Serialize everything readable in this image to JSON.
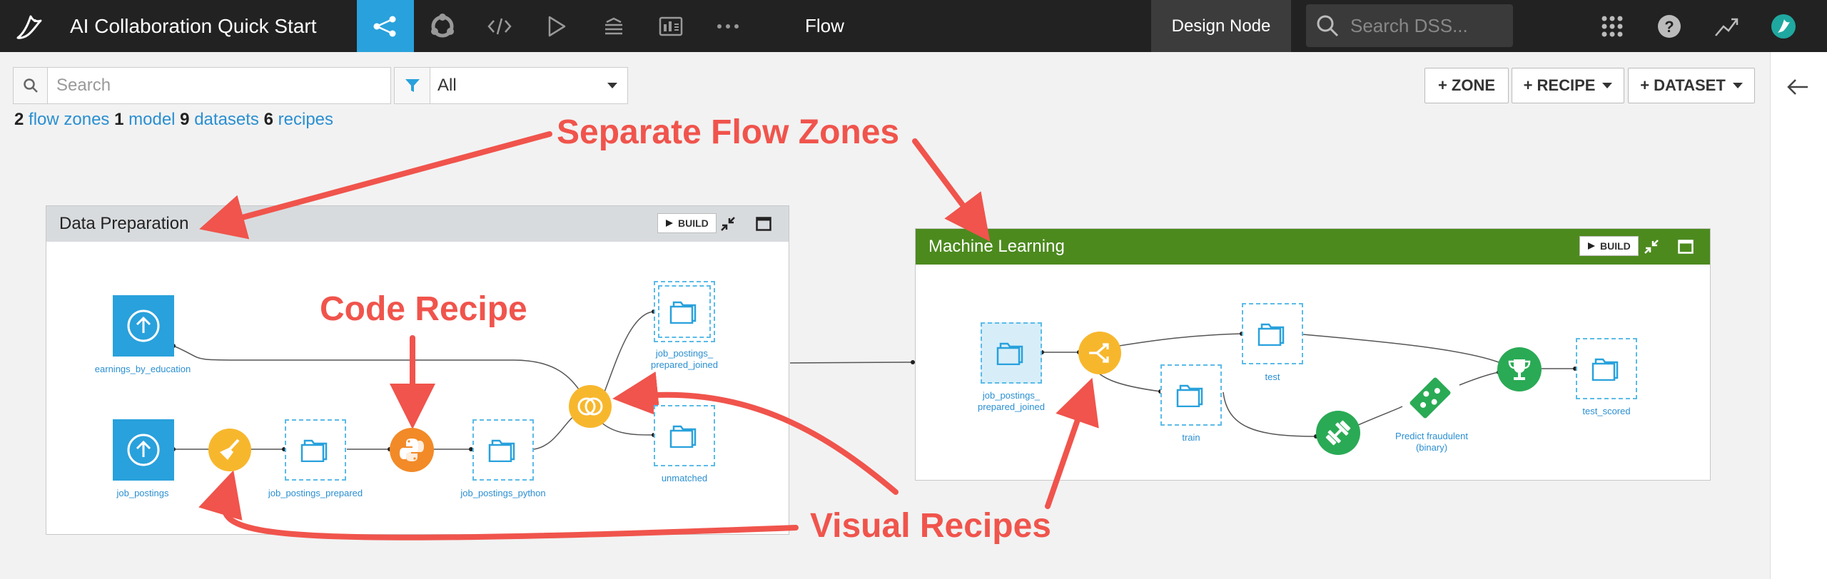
{
  "topbar": {
    "project_title": "AI Collaboration Quick Start",
    "icons": [
      "flow-icon",
      "jobs-icon",
      "code-icon",
      "run-icon",
      "library-icon",
      "dashboard-icon",
      "more-icon"
    ],
    "section": "Flow",
    "design_node": "Design Node",
    "search_placeholder": "Search DSS...",
    "right_icons": [
      "apps-grid-icon",
      "help-icon",
      "trend-icon",
      "profile-icon"
    ]
  },
  "toolbar": {
    "search_placeholder": "Search",
    "filter_value": "All",
    "zone_btn": "+ ZONE",
    "recipe_btn": "+ RECIPE",
    "dataset_btn": "+ DATASET"
  },
  "summary": {
    "zones_count": "2",
    "zones_label": "flow zones",
    "model_count": "1",
    "model_label": "model",
    "datasets_count": "9",
    "datasets_label": "datasets",
    "recipes_count": "6",
    "recipes_label": "recipes"
  },
  "zones": {
    "prep": {
      "title": "Data Preparation",
      "build": "BUILD",
      "color": "#d8dbde"
    },
    "ml": {
      "title": "Machine Learning",
      "build": "BUILD",
      "color": "#4c8a1e"
    }
  },
  "nodes": {
    "earnings": "earnings_by_education",
    "job_postings": "job_postings",
    "prepared": "job_postings_prepared",
    "python": "job_postings_python",
    "joined_l1": "job_postings_",
    "joined_l2": "prepared_joined",
    "unmatched": "unmatched",
    "ml_joined_l1": "job_postings_",
    "ml_joined_l2": "prepared_joined",
    "train": "train",
    "test": "test",
    "model_l1": "Predict fraudulent",
    "model_l2": "(binary)",
    "test_scored": "test_scored"
  },
  "annotations": {
    "zones": "Separate Flow Zones",
    "code": "Code Recipe",
    "visual": "Visual Recipes",
    "color": "#f0544c"
  },
  "colors": {
    "accent": "#29a1dc",
    "visual_recipe": "#f7b72d",
    "python_recipe": "#f28a28",
    "ml_recipe": "#2aaa55",
    "link": "#2a8fd1"
  }
}
